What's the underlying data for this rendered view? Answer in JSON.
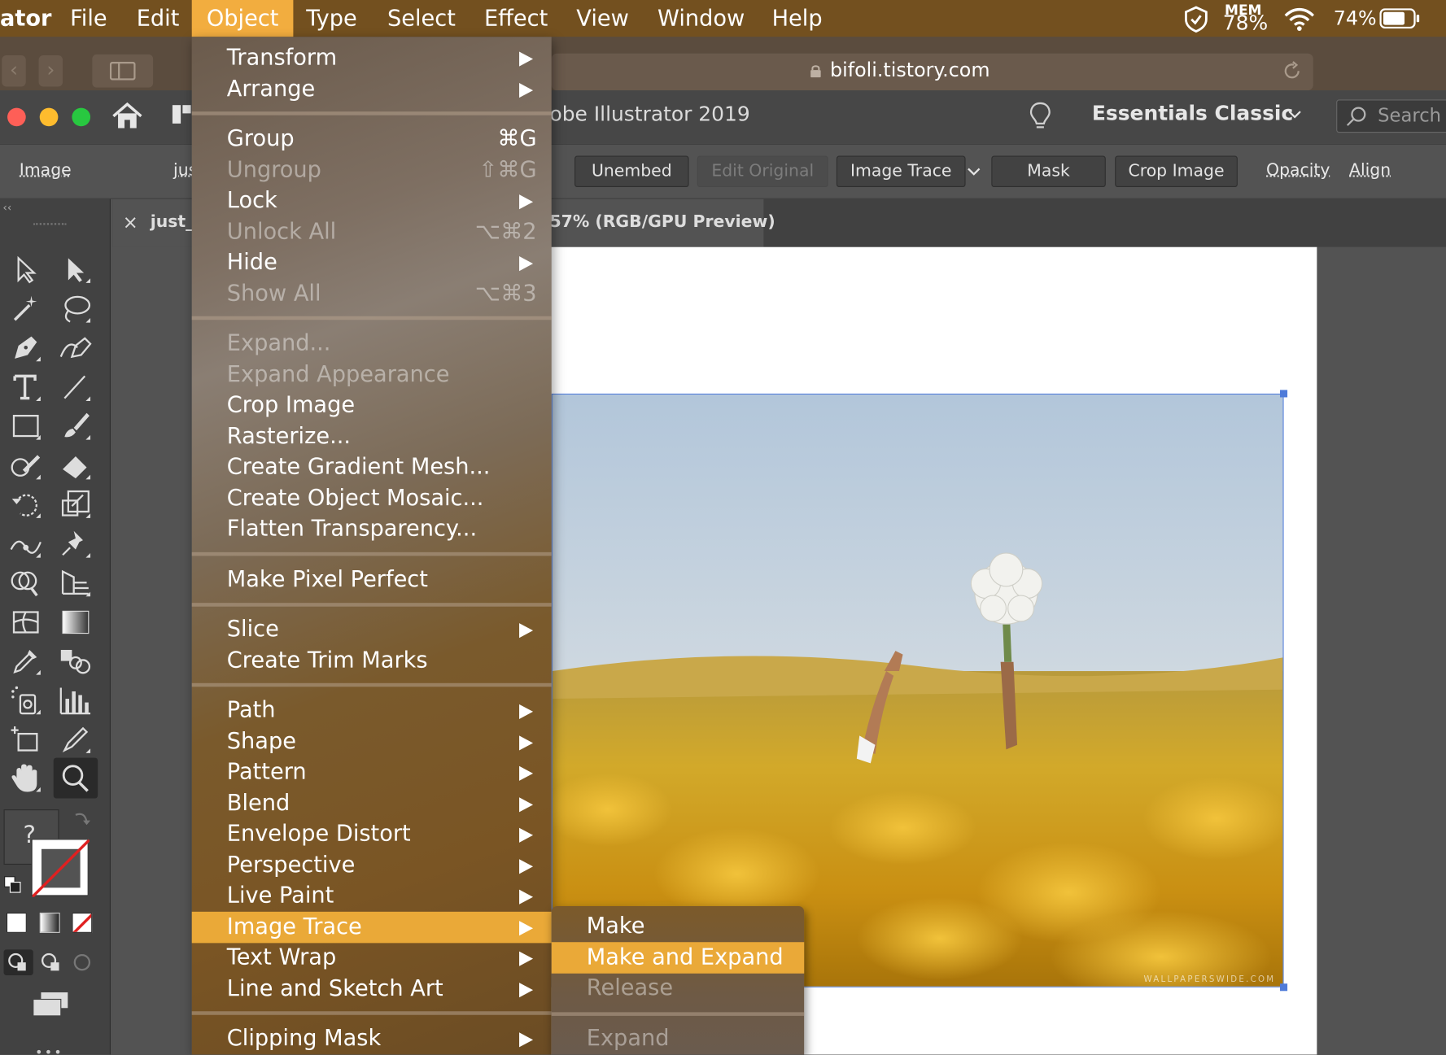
{
  "menubar": {
    "app_name": "ator",
    "items": [
      "File",
      "Edit",
      "Object",
      "Type",
      "Select",
      "Effect",
      "View",
      "Window",
      "Help"
    ],
    "active_item": "Object",
    "mem_label": "MEM",
    "mem_value": "78%",
    "battery_percent": "74%"
  },
  "browser": {
    "url": "bifoli.tistory.com"
  },
  "app": {
    "title": "obe Illustrator 2019",
    "workspace": "Essentials Classic",
    "search_placeholder": "Search A"
  },
  "controlbar": {
    "selection_type": "Image",
    "filename_fragment": "jus",
    "buttons": {
      "unembed": "Unembed",
      "edit_original": "Edit Original",
      "image_trace": "Image Trace",
      "mask": "Mask",
      "crop_image": "Crop Image"
    },
    "links": {
      "opacity": "Opacity",
      "align": "Align"
    }
  },
  "document_tab": {
    "close": "×",
    "name": "just_",
    "zoom_info": "57% (RGB/GPU Preview)"
  },
  "toolbar": {
    "collapse": "‹‹",
    "unknown_swatch": "?"
  },
  "photo": {
    "watermark": "WALLPAPERSWIDE.COM"
  },
  "object_menu": {
    "items": [
      {
        "label": "Transform",
        "shortcut": "",
        "submenu": true,
        "enabled": true
      },
      {
        "label": "Arrange",
        "shortcut": "",
        "submenu": true,
        "enabled": true
      },
      {
        "label": "Group",
        "shortcut": "⌘G",
        "submenu": false,
        "enabled": true
      },
      {
        "label": "Ungroup",
        "shortcut": "⇧⌘G",
        "submenu": false,
        "enabled": false
      },
      {
        "label": "Lock",
        "shortcut": "",
        "submenu": true,
        "enabled": true
      },
      {
        "label": "Unlock All",
        "shortcut": "⌥⌘2",
        "submenu": false,
        "enabled": false
      },
      {
        "label": "Hide",
        "shortcut": "",
        "submenu": true,
        "enabled": true
      },
      {
        "label": "Show All",
        "shortcut": "⌥⌘3",
        "submenu": false,
        "enabled": false
      },
      {
        "label": "Expand...",
        "shortcut": "",
        "submenu": false,
        "enabled": false
      },
      {
        "label": "Expand Appearance",
        "shortcut": "",
        "submenu": false,
        "enabled": false
      },
      {
        "label": "Crop Image",
        "shortcut": "",
        "submenu": false,
        "enabled": true
      },
      {
        "label": "Rasterize...",
        "shortcut": "",
        "submenu": false,
        "enabled": true
      },
      {
        "label": "Create Gradient Mesh...",
        "shortcut": "",
        "submenu": false,
        "enabled": true
      },
      {
        "label": "Create Object Mosaic...",
        "shortcut": "",
        "submenu": false,
        "enabled": true
      },
      {
        "label": "Flatten Transparency...",
        "shortcut": "",
        "submenu": false,
        "enabled": true
      },
      {
        "label": "Make Pixel Perfect",
        "shortcut": "",
        "submenu": false,
        "enabled": true
      },
      {
        "label": "Slice",
        "shortcut": "",
        "submenu": true,
        "enabled": true
      },
      {
        "label": "Create Trim Marks",
        "shortcut": "",
        "submenu": false,
        "enabled": true
      },
      {
        "label": "Path",
        "shortcut": "",
        "submenu": true,
        "enabled": true
      },
      {
        "label": "Shape",
        "shortcut": "",
        "submenu": true,
        "enabled": true
      },
      {
        "label": "Pattern",
        "shortcut": "",
        "submenu": true,
        "enabled": true
      },
      {
        "label": "Blend",
        "shortcut": "",
        "submenu": true,
        "enabled": true
      },
      {
        "label": "Envelope Distort",
        "shortcut": "",
        "submenu": true,
        "enabled": true
      },
      {
        "label": "Perspective",
        "shortcut": "",
        "submenu": true,
        "enabled": true
      },
      {
        "label": "Live Paint",
        "shortcut": "",
        "submenu": true,
        "enabled": true
      },
      {
        "label": "Image Trace",
        "shortcut": "",
        "submenu": true,
        "enabled": true,
        "highlighted": true
      },
      {
        "label": "Text Wrap",
        "shortcut": "",
        "submenu": true,
        "enabled": true
      },
      {
        "label": "Line and Sketch Art",
        "shortcut": "",
        "submenu": true,
        "enabled": true
      },
      {
        "label": "Clipping Mask",
        "shortcut": "",
        "submenu": true,
        "enabled": true
      }
    ]
  },
  "image_trace_submenu": {
    "items": [
      {
        "label": "Make",
        "enabled": true
      },
      {
        "label": "Make and Expand",
        "enabled": true,
        "highlighted": true
      },
      {
        "label": "Release",
        "enabled": false
      },
      {
        "label": "Expand",
        "enabled": false
      }
    ]
  },
  "colors": {
    "menubar": "#73501f",
    "highlight": "#eaa938",
    "selection": "#4f7bd9"
  }
}
